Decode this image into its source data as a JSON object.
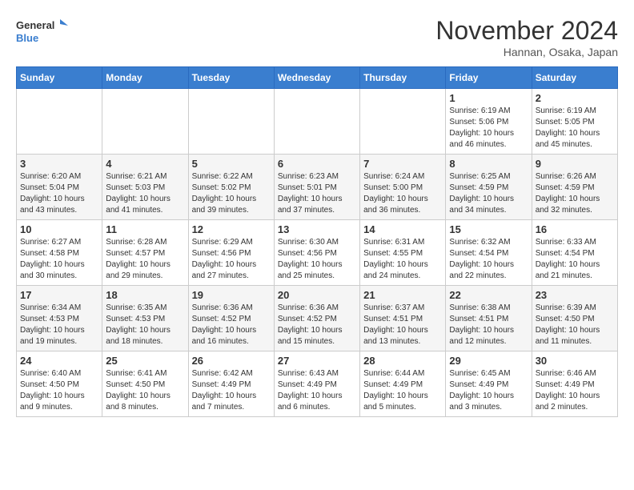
{
  "header": {
    "logo_general": "General",
    "logo_blue": "Blue",
    "month_title": "November 2024",
    "location": "Hannan, Osaka, Japan"
  },
  "weekdays": [
    "Sunday",
    "Monday",
    "Tuesday",
    "Wednesday",
    "Thursday",
    "Friday",
    "Saturday"
  ],
  "weeks": [
    [
      {
        "day": "",
        "info": ""
      },
      {
        "day": "",
        "info": ""
      },
      {
        "day": "",
        "info": ""
      },
      {
        "day": "",
        "info": ""
      },
      {
        "day": "",
        "info": ""
      },
      {
        "day": "1",
        "info": "Sunrise: 6:19 AM\nSunset: 5:06 PM\nDaylight: 10 hours\nand 46 minutes."
      },
      {
        "day": "2",
        "info": "Sunrise: 6:19 AM\nSunset: 5:05 PM\nDaylight: 10 hours\nand 45 minutes."
      }
    ],
    [
      {
        "day": "3",
        "info": "Sunrise: 6:20 AM\nSunset: 5:04 PM\nDaylight: 10 hours\nand 43 minutes."
      },
      {
        "day": "4",
        "info": "Sunrise: 6:21 AM\nSunset: 5:03 PM\nDaylight: 10 hours\nand 41 minutes."
      },
      {
        "day": "5",
        "info": "Sunrise: 6:22 AM\nSunset: 5:02 PM\nDaylight: 10 hours\nand 39 minutes."
      },
      {
        "day": "6",
        "info": "Sunrise: 6:23 AM\nSunset: 5:01 PM\nDaylight: 10 hours\nand 37 minutes."
      },
      {
        "day": "7",
        "info": "Sunrise: 6:24 AM\nSunset: 5:00 PM\nDaylight: 10 hours\nand 36 minutes."
      },
      {
        "day": "8",
        "info": "Sunrise: 6:25 AM\nSunset: 4:59 PM\nDaylight: 10 hours\nand 34 minutes."
      },
      {
        "day": "9",
        "info": "Sunrise: 6:26 AM\nSunset: 4:59 PM\nDaylight: 10 hours\nand 32 minutes."
      }
    ],
    [
      {
        "day": "10",
        "info": "Sunrise: 6:27 AM\nSunset: 4:58 PM\nDaylight: 10 hours\nand 30 minutes."
      },
      {
        "day": "11",
        "info": "Sunrise: 6:28 AM\nSunset: 4:57 PM\nDaylight: 10 hours\nand 29 minutes."
      },
      {
        "day": "12",
        "info": "Sunrise: 6:29 AM\nSunset: 4:56 PM\nDaylight: 10 hours\nand 27 minutes."
      },
      {
        "day": "13",
        "info": "Sunrise: 6:30 AM\nSunset: 4:56 PM\nDaylight: 10 hours\nand 25 minutes."
      },
      {
        "day": "14",
        "info": "Sunrise: 6:31 AM\nSunset: 4:55 PM\nDaylight: 10 hours\nand 24 minutes."
      },
      {
        "day": "15",
        "info": "Sunrise: 6:32 AM\nSunset: 4:54 PM\nDaylight: 10 hours\nand 22 minutes."
      },
      {
        "day": "16",
        "info": "Sunrise: 6:33 AM\nSunset: 4:54 PM\nDaylight: 10 hours\nand 21 minutes."
      }
    ],
    [
      {
        "day": "17",
        "info": "Sunrise: 6:34 AM\nSunset: 4:53 PM\nDaylight: 10 hours\nand 19 minutes."
      },
      {
        "day": "18",
        "info": "Sunrise: 6:35 AM\nSunset: 4:53 PM\nDaylight: 10 hours\nand 18 minutes."
      },
      {
        "day": "19",
        "info": "Sunrise: 6:36 AM\nSunset: 4:52 PM\nDaylight: 10 hours\nand 16 minutes."
      },
      {
        "day": "20",
        "info": "Sunrise: 6:36 AM\nSunset: 4:52 PM\nDaylight: 10 hours\nand 15 minutes."
      },
      {
        "day": "21",
        "info": "Sunrise: 6:37 AM\nSunset: 4:51 PM\nDaylight: 10 hours\nand 13 minutes."
      },
      {
        "day": "22",
        "info": "Sunrise: 6:38 AM\nSunset: 4:51 PM\nDaylight: 10 hours\nand 12 minutes."
      },
      {
        "day": "23",
        "info": "Sunrise: 6:39 AM\nSunset: 4:50 PM\nDaylight: 10 hours\nand 11 minutes."
      }
    ],
    [
      {
        "day": "24",
        "info": "Sunrise: 6:40 AM\nSunset: 4:50 PM\nDaylight: 10 hours\nand 9 minutes."
      },
      {
        "day": "25",
        "info": "Sunrise: 6:41 AM\nSunset: 4:50 PM\nDaylight: 10 hours\nand 8 minutes."
      },
      {
        "day": "26",
        "info": "Sunrise: 6:42 AM\nSunset: 4:49 PM\nDaylight: 10 hours\nand 7 minutes."
      },
      {
        "day": "27",
        "info": "Sunrise: 6:43 AM\nSunset: 4:49 PM\nDaylight: 10 hours\nand 6 minutes."
      },
      {
        "day": "28",
        "info": "Sunrise: 6:44 AM\nSunset: 4:49 PM\nDaylight: 10 hours\nand 5 minutes."
      },
      {
        "day": "29",
        "info": "Sunrise: 6:45 AM\nSunset: 4:49 PM\nDaylight: 10 hours\nand 3 minutes."
      },
      {
        "day": "30",
        "info": "Sunrise: 6:46 AM\nSunset: 4:49 PM\nDaylight: 10 hours\nand 2 minutes."
      }
    ]
  ]
}
